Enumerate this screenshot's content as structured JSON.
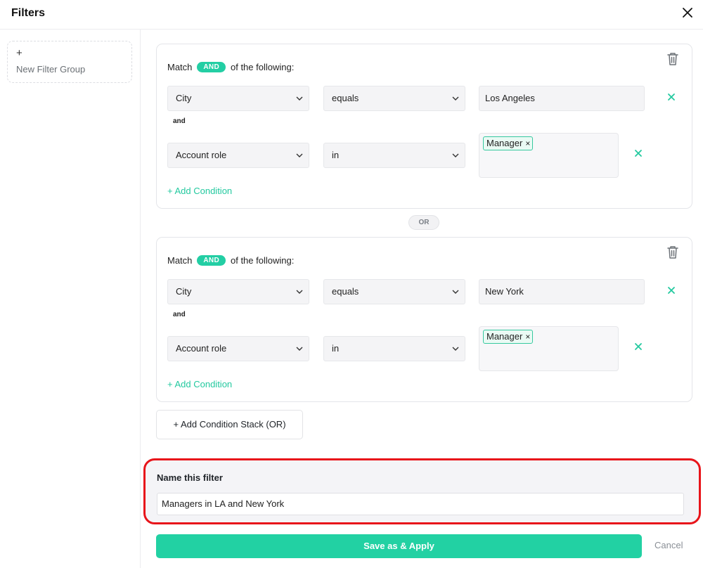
{
  "header": {
    "title": "Filters"
  },
  "sidebar": {
    "new_group_plus": "+",
    "new_group_label": "New Filter Group"
  },
  "groups": [
    {
      "match_prefix": "Match",
      "match_mode": "AND",
      "match_suffix": "of the following:",
      "conditions": [
        {
          "field": "City",
          "operator": "equals",
          "value": "Los Angeles"
        },
        {
          "connector": "and",
          "field": "Account role",
          "operator": "in",
          "tags": [
            "Manager"
          ]
        }
      ],
      "add_condition": "+ Add Condition"
    },
    {
      "match_prefix": "Match",
      "match_mode": "AND",
      "match_suffix": "of the following:",
      "conditions": [
        {
          "field": "City",
          "operator": "equals",
          "value": "New York"
        },
        {
          "connector": "and",
          "field": "Account role",
          "operator": "in",
          "tags": [
            "Manager"
          ]
        }
      ],
      "add_condition": "+ Add Condition"
    }
  ],
  "or_separator": "OR",
  "add_stack": "+ Add Condition Stack (OR)",
  "name_section": {
    "label": "Name this filter",
    "value": "Managers in LA and New York"
  },
  "actions": {
    "save": "Save as & Apply",
    "cancel": "Cancel"
  },
  "tag_remove": "×",
  "colors": {
    "accent": "#23cea4",
    "highlight_border": "#e8141a"
  }
}
